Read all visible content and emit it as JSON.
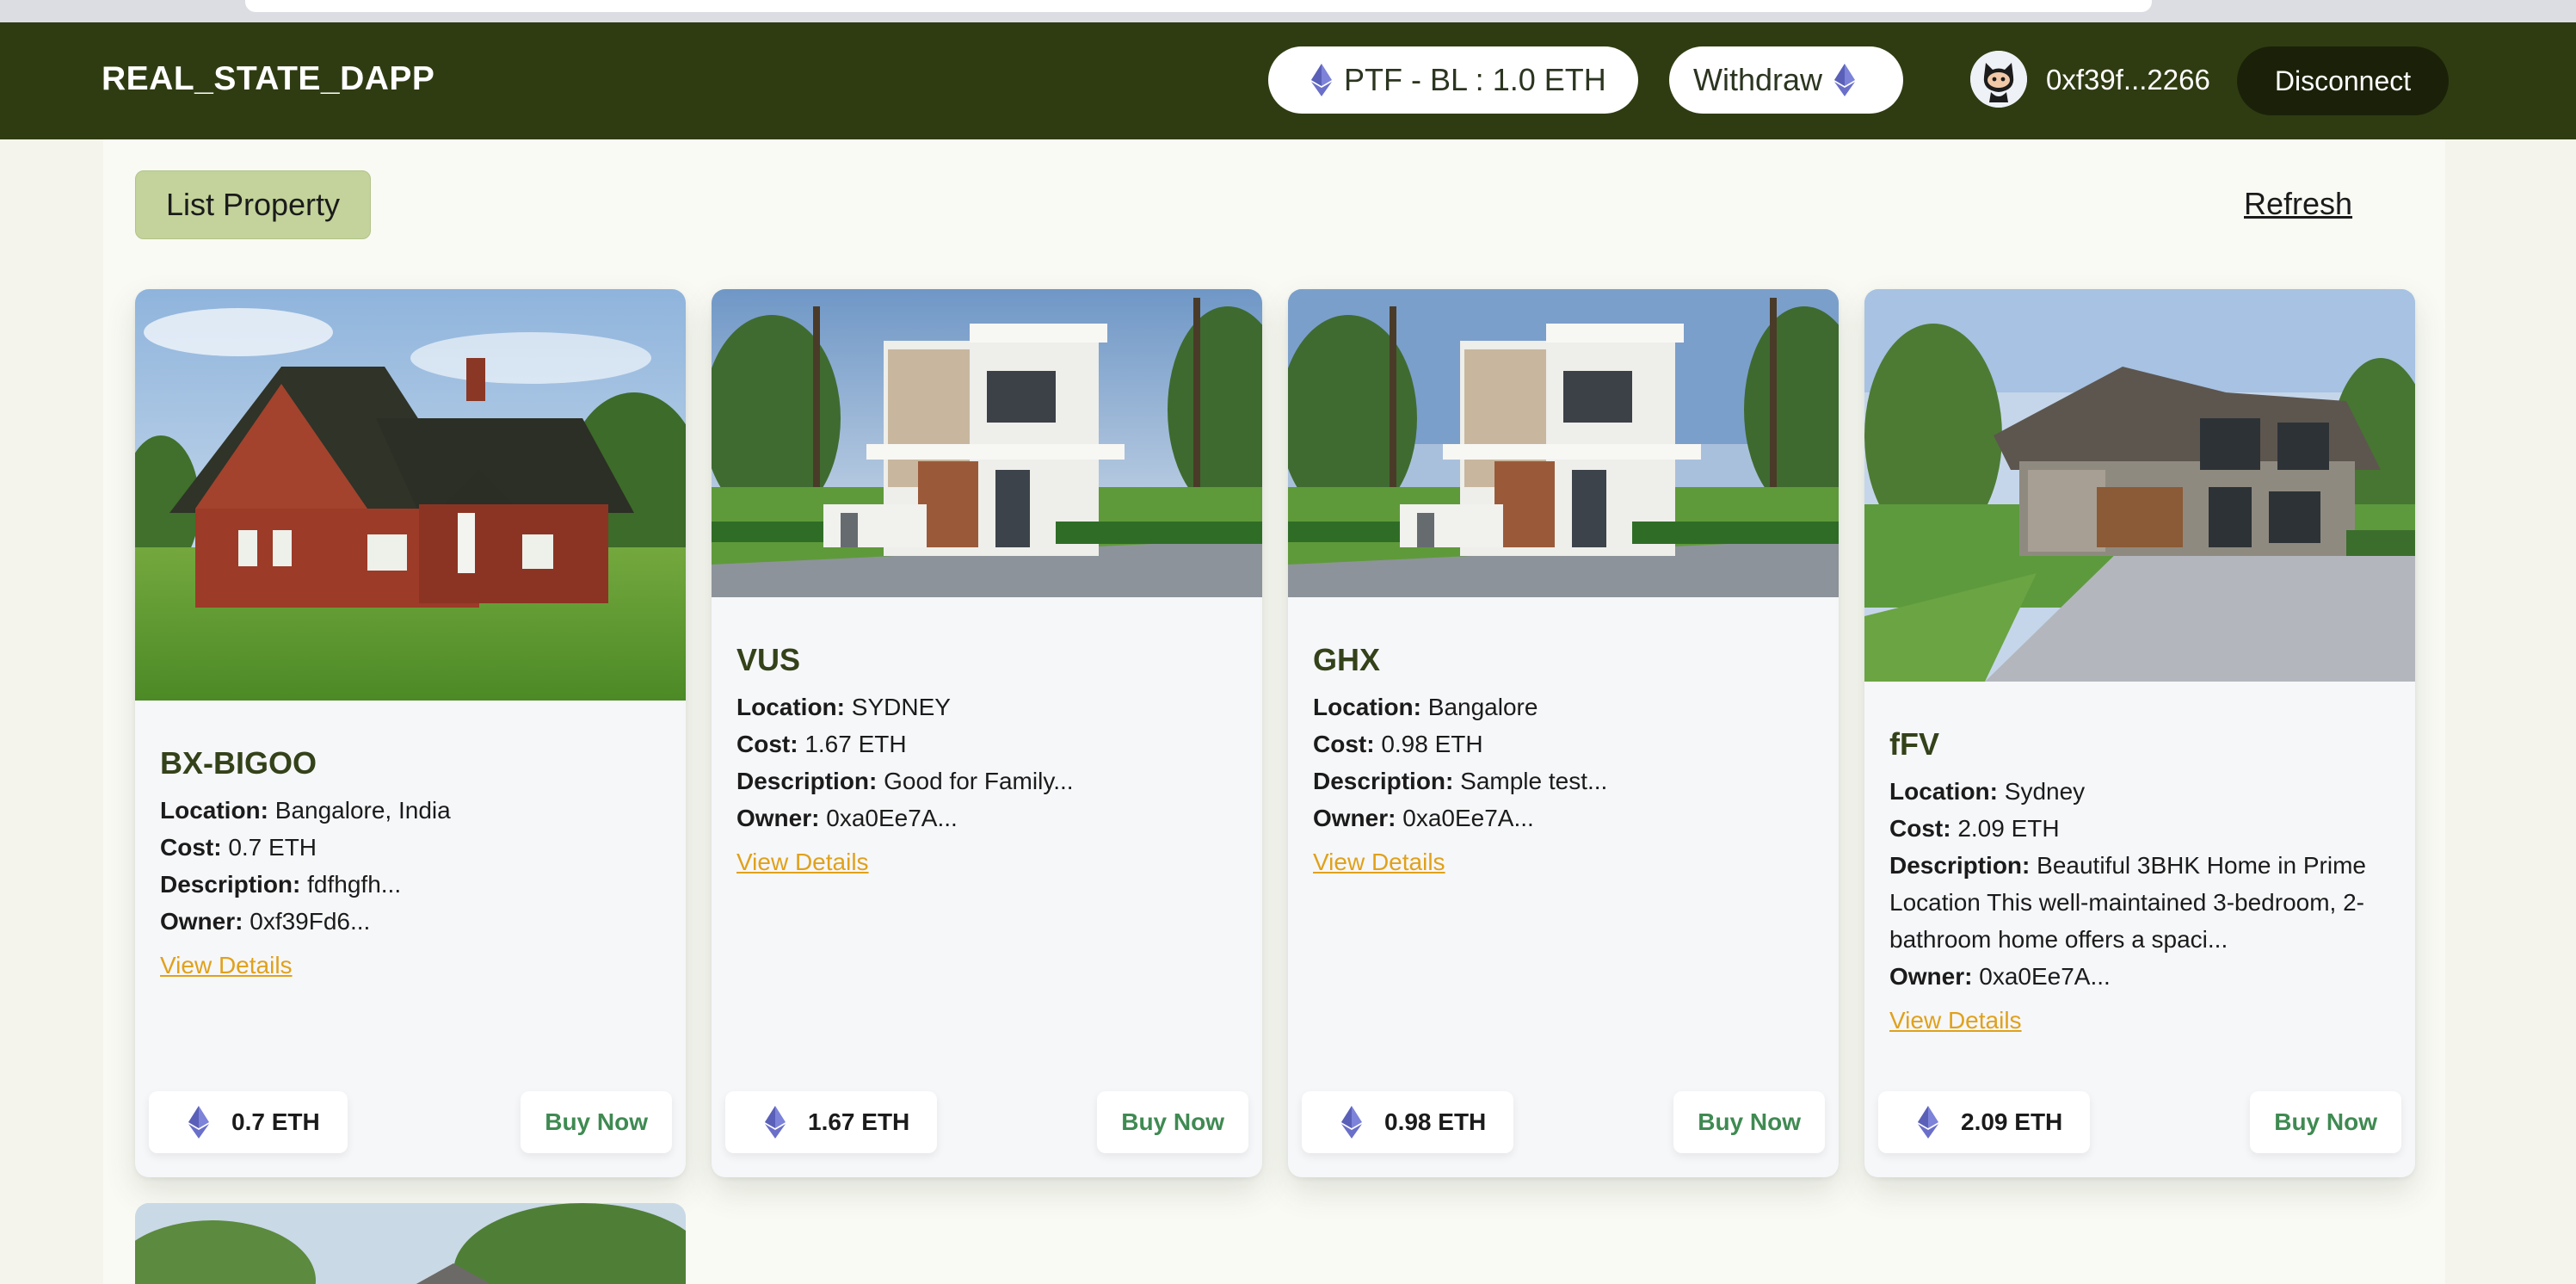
{
  "header": {
    "brand": "REAL_STATE_DAPP",
    "balance_label": "PTF - BL : 1.0 ETH",
    "withdraw_label": "Withdraw",
    "address": "0xf39f...2266",
    "disconnect_label": "Disconnect"
  },
  "toolbar": {
    "list_property_label": "List Property",
    "refresh_label": "Refresh"
  },
  "labels": {
    "location": "Location:",
    "cost": "Cost:",
    "description": "Description:",
    "owner": "Owner:",
    "view_details": "View Details",
    "buy_now": "Buy Now"
  },
  "properties": [
    {
      "title": "BX-BIGOO",
      "location": "Bangalore, India",
      "cost": "0.7 ETH",
      "description": "fdfhgfh...",
      "owner": "0xf39Fd6...",
      "price": "0.7 ETH",
      "image": "brick-house"
    },
    {
      "title": "VUS",
      "location": "SYDNEY",
      "cost": "1.67 ETH",
      "description": "Good for Family...",
      "owner": "0xa0Ee7A...",
      "price": "1.67 ETH",
      "image": "modern-villa"
    },
    {
      "title": "GHX",
      "location": "Bangalore",
      "cost": "0.98 ETH",
      "description": "Sample test...",
      "owner": "0xa0Ee7A...",
      "price": "0.98 ETH",
      "image": "modern-villa"
    },
    {
      "title": "fFV",
      "location": "Sydney",
      "cost": "2.09 ETH",
      "description": "Beautiful 3BHK Home in Prime Location This well-maintained 3-bedroom, 2-bathroom home offers a spaci...",
      "owner": "0xa0Ee7A...",
      "price": "2.09 ETH",
      "image": "stone-mansion"
    }
  ],
  "icons": {
    "currency": "ethereum-icon",
    "avatar": "github-octocat-icon"
  },
  "colors": {
    "header_bg": "#2f3c12",
    "accent_green": "#c3d39b",
    "title_green": "#34421a",
    "buy_green": "#3f8a52",
    "link_orange": "#e0a11b",
    "eth_purple": "#6a6fc9"
  }
}
